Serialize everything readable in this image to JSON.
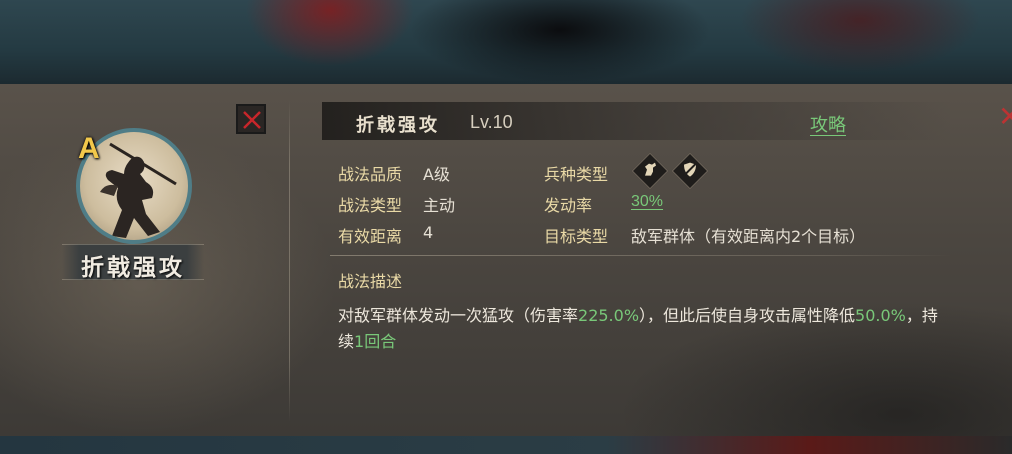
{
  "skill": {
    "grade": "A",
    "name": "折戟强攻",
    "level": "Lv.10",
    "strategy_link": "攻略"
  },
  "attributes": {
    "quality_label": "战法品质",
    "quality_value": "A级",
    "type_label": "战法类型",
    "type_value": "主动",
    "range_label": "有效距离",
    "range_value": "4",
    "troop_label": "兵种类型",
    "troop_icons": [
      "cavalry-icon",
      "shield-icon"
    ],
    "rate_label": "发动率",
    "rate_value": "30%",
    "target_label": "目标类型",
    "target_value": "敌军群体（有效距离内2个目标）"
  },
  "description": {
    "title": "战法描述",
    "part1": "对敌军群体发动一次猛攻（伤害率",
    "damage_rate": "225.0%",
    "part2": "），但此后使自身攻击属性降低",
    "reduce_value": "50.0%",
    "part3": "，持续",
    "duration_value": "1回合"
  },
  "colors": {
    "highlight": "#79c879",
    "label": "#e9d9a6",
    "grade": "#f2c84b",
    "close": "#c8262b"
  }
}
